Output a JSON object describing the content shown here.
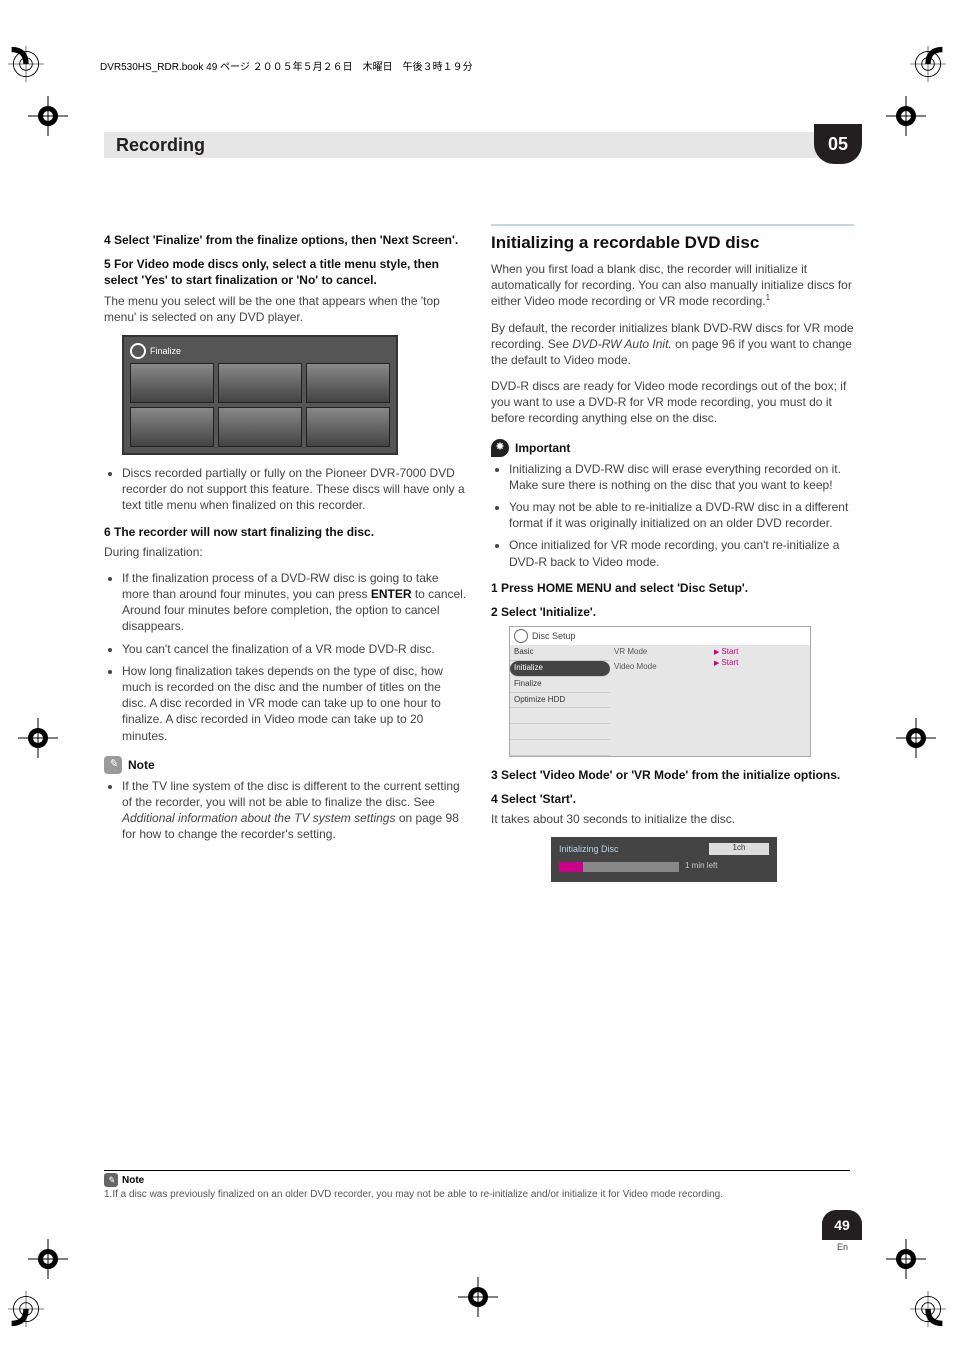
{
  "header_line": "DVR530HS_RDR.book  49 ページ  ２００５年５月２６日　木曜日　午後３時１９分",
  "section_title": "Recording",
  "section_number": "05",
  "left": {
    "step4": "4    Select 'Finalize' from the finalize options, then 'Next Screen'.",
    "step5": "5    For Video mode discs only, select a title menu style, then select 'Yes' to start finalization or 'No' to cancel.",
    "step5_p": "The menu you select will be the one that appears when the 'top menu' is selected on any DVD player.",
    "finalize_title": "Finalize",
    "bullet1": "Discs recorded partially or fully on the Pioneer DVR-7000 DVD recorder do not support this feature. These discs will have only a text title menu when finalized on this recorder.",
    "step6": "6    The recorder will now start finalizing the disc.",
    "step6_p": "During finalization:",
    "b6a_pre": "If the finalization process of a DVD-RW disc is going to take more than around four minutes, you can press ",
    "b6a_enter": "ENTER",
    "b6a_post": " to cancel. Around four minutes before completion, the option to cancel disappears.",
    "b6b": "You can't cancel the finalization of a VR mode DVD-R disc.",
    "b6c": "How long finalization takes depends on the type of disc, how much is recorded on the disc and the number of titles on the disc. A disc recorded in VR mode can take up to one hour to finalize. A disc recorded in Video mode can take up to 20 minutes.",
    "note_label": "Note",
    "note1_pre": "If the TV line system of the disc is different to the current setting of the recorder, you will not be able to finalize the disc. See ",
    "note1_em": "Additional information about the TV system settings",
    "note1_post": " on page 98 for how to change the recorder's setting."
  },
  "right": {
    "heading": "Initializing a recordable DVD disc",
    "p1": "When you first load a blank disc, the recorder will initialize it automatically for recording. You can also manually initialize discs for either Video mode recording or VR mode recording.",
    "p1_sup": "1",
    "p2_pre": "By default, the recorder initializes blank DVD-RW discs for VR mode recording. See ",
    "p2_em": "DVD-RW Auto Init.",
    "p2_post": " on page 96 if you want to change the default to Video mode.",
    "p3": "DVD-R discs are ready for Video mode recordings out of the box; if you want to use a DVD-R for VR mode recording, you must do it before recording anything else on the disc.",
    "important_label": "Important",
    "imp1": "Initializing a DVD-RW disc will erase everything recorded on it. Make sure there is nothing on the disc that you want to keep!",
    "imp2": "You may not be able to re-initialize a DVD-RW disc in a different format if it was originally initialized on an older DVD recorder.",
    "imp3": "Once initialized for VR mode recording, you can't re-initialize a DVD-R back to Video mode.",
    "step1": "1    Press HOME MENU and select 'Disc Setup'.",
    "step2": "2    Select 'Initialize'.",
    "menu": {
      "title": "Disc Setup",
      "side": [
        "Basic",
        "Initialize",
        "Finalize",
        "Optimize HDD"
      ],
      "mid": [
        "VR Mode",
        "Video Mode"
      ],
      "right": [
        "Start",
        "Start"
      ]
    },
    "step3": "3    Select 'Video Mode' or 'VR Mode' from the initialize options.",
    "step4r": "4    Select 'Start'.",
    "step4r_p": "It takes about 30 seconds to initialize the disc.",
    "init": {
      "title": "Initializing Disc",
      "ch": "1ch",
      "time": "1 min left"
    }
  },
  "footnote": {
    "label": "Note",
    "text": "1.If a disc was previously finalized on an older DVD recorder, you may not be able to re-initialize and/or initialize it for Video mode recording."
  },
  "page_number": "49",
  "page_lang": "En"
}
